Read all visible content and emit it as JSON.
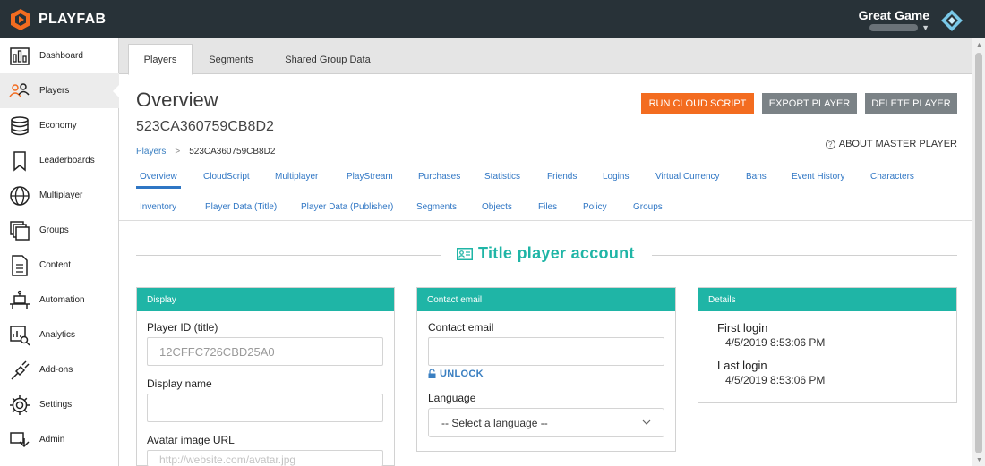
{
  "brand": {
    "name": "PLAYFAB"
  },
  "game": {
    "title": "Great Game"
  },
  "sidebar": {
    "items": [
      {
        "label": "Dashboard",
        "icon": "dashboard-icon"
      },
      {
        "label": "Players",
        "icon": "players-icon",
        "active": true
      },
      {
        "label": "Economy",
        "icon": "economy-icon"
      },
      {
        "label": "Leaderboards",
        "icon": "leaderboards-icon"
      },
      {
        "label": "Multiplayer",
        "icon": "multiplayer-icon"
      },
      {
        "label": "Groups",
        "icon": "groups-icon"
      },
      {
        "label": "Content",
        "icon": "content-icon"
      },
      {
        "label": "Automation",
        "icon": "automation-icon"
      },
      {
        "label": "Analytics",
        "icon": "analytics-icon"
      },
      {
        "label": "Add-ons",
        "icon": "addons-icon"
      },
      {
        "label": "Settings",
        "icon": "settings-icon"
      },
      {
        "label": "Admin",
        "icon": "admin-icon"
      }
    ]
  },
  "tabs": [
    "Players",
    "Segments",
    "Shared Group Data"
  ],
  "header": {
    "title": "Overview",
    "player_id": "523CA360759CB8D2",
    "breadcrumb": {
      "root": "Players",
      "separator": ">",
      "current": "523CA360759CB8D2"
    },
    "about": "ABOUT MASTER PLAYER"
  },
  "actions": {
    "run_cloud_script": "RUN CLOUD SCRIPT",
    "export_player": "EXPORT PLAYER",
    "delete_player": "DELETE PLAYER"
  },
  "subtabs_row1": [
    "Overview",
    "CloudScript",
    "Multiplayer",
    "PlayStream",
    "Purchases",
    "Statistics",
    "Friends",
    "Logins",
    "Virtual Currency",
    "Bans",
    "Event History",
    "Characters"
  ],
  "subtabs_row2": [
    "Inventory",
    "Player Data (Title)",
    "Player Data (Publisher)",
    "Segments",
    "Objects",
    "Files",
    "Policy",
    "Groups"
  ],
  "section": {
    "title": "Title player account"
  },
  "display_card": {
    "header": "Display",
    "player_id_label": "Player ID (title)",
    "player_id_value": "12CFFC726CBD25A0",
    "display_name_label": "Display name",
    "display_name_value": "",
    "avatar_label": "Avatar image URL",
    "avatar_placeholder": "http://website.com/avatar.jpg"
  },
  "contact_card": {
    "header": "Contact email",
    "email_label": "Contact email",
    "email_value": "",
    "unlock": "UNLOCK",
    "language_label": "Language",
    "language_value": "-- Select a language --"
  },
  "details_card": {
    "header": "Details",
    "first_login_label": "First login",
    "first_login_value": "4/5/2019 8:53:06 PM",
    "last_login_label": "Last login",
    "last_login_value": "4/5/2019 8:53:06 PM"
  },
  "colors": {
    "topbar": "#283238",
    "accent_teal": "#1fb5a6",
    "accent_orange": "#f36c20",
    "button_gray": "#7b8286",
    "link_blue": "#2f76c4"
  }
}
